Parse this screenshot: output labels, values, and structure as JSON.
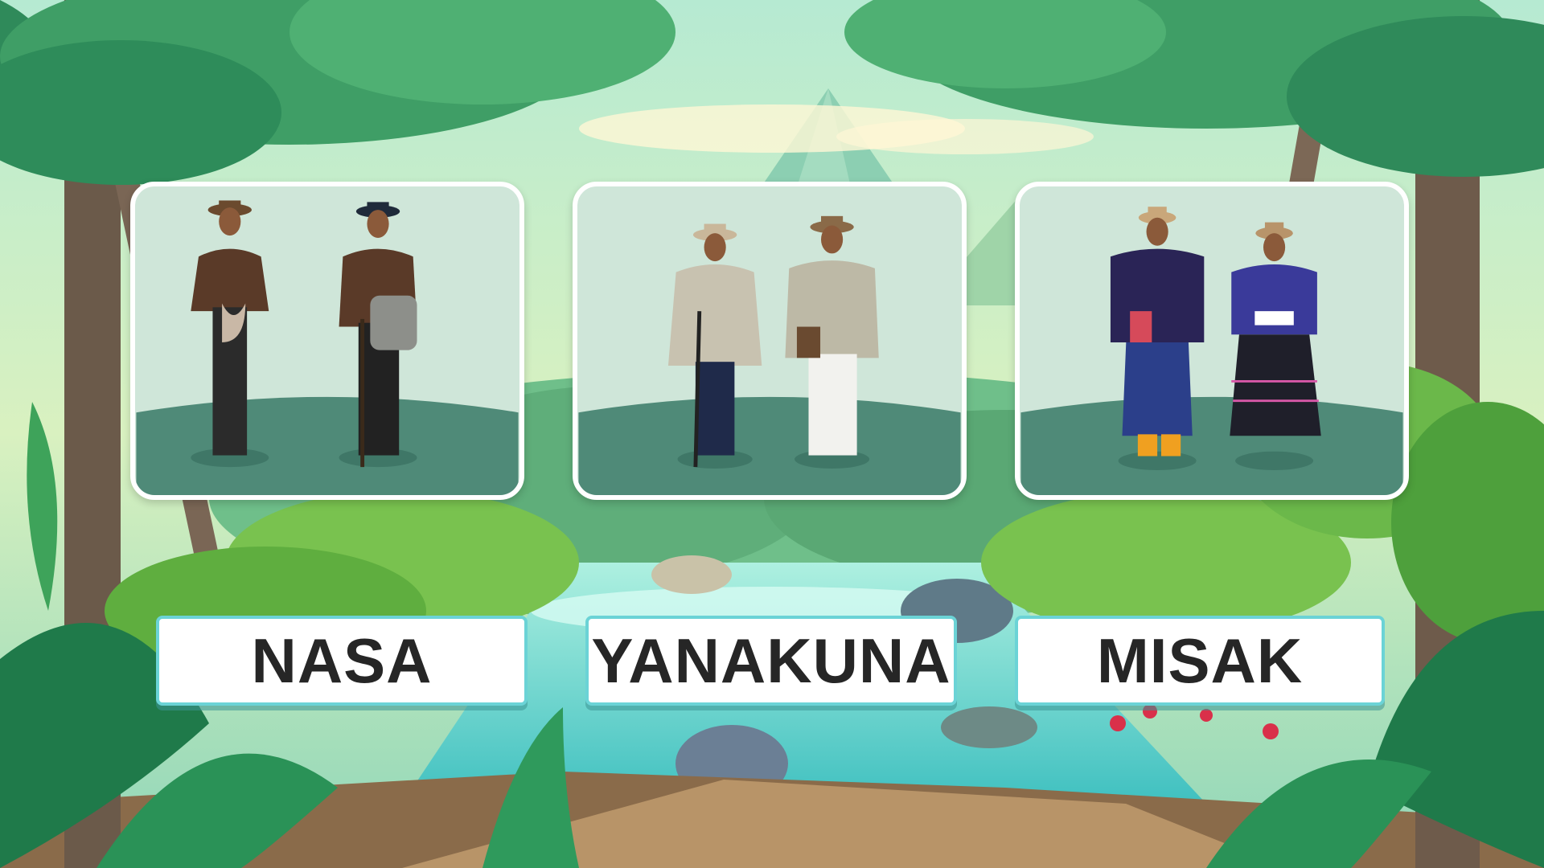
{
  "cards": [
    {
      "id": "nasa",
      "label": "NASA"
    },
    {
      "id": "yanakuna",
      "label": "YANAKUNA"
    },
    {
      "id": "misak",
      "label": "MISAK"
    }
  ],
  "colors": {
    "label_border": "#6bd3d6",
    "label_text": "#262626",
    "card_bg": "#cfe6d9",
    "card_ground": "#4f8a78"
  }
}
